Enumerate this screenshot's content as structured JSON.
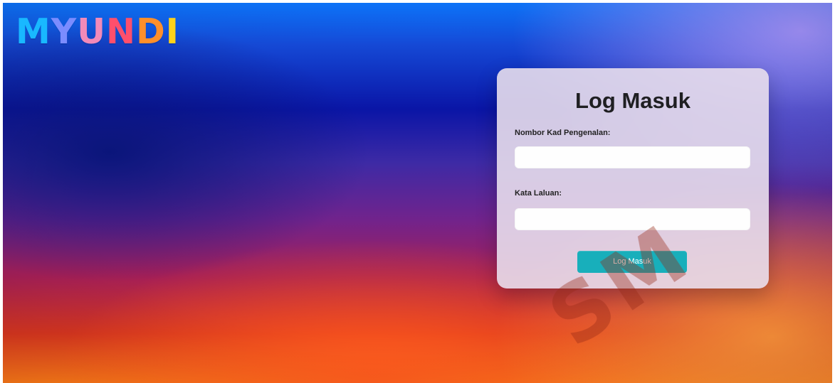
{
  "branding": {
    "logo_parts": [
      {
        "text": "M",
        "color": "#19b8ff"
      },
      {
        "text": "Y",
        "color": "#7b8cff"
      },
      {
        "text": "U",
        "color": "#f28ab9"
      },
      {
        "text": "N",
        "color": "#ff4f6c"
      },
      {
        "text": "D",
        "color": "#ff8f2a"
      },
      {
        "text": "I",
        "color": "#ffd21a"
      }
    ]
  },
  "login": {
    "title": "Log Masuk",
    "id_label": "Nombor Kad Pengenalan:",
    "id_value": "",
    "id_placeholder": "",
    "password_label": "Kata Laluan:",
    "password_value": "",
    "password_placeholder": "",
    "button_label": "Log Masuk"
  },
  "watermark": {
    "text": "SM"
  },
  "colors": {
    "button": "#18afbb",
    "card": "rgba(232, 222, 236, 0.90)"
  }
}
